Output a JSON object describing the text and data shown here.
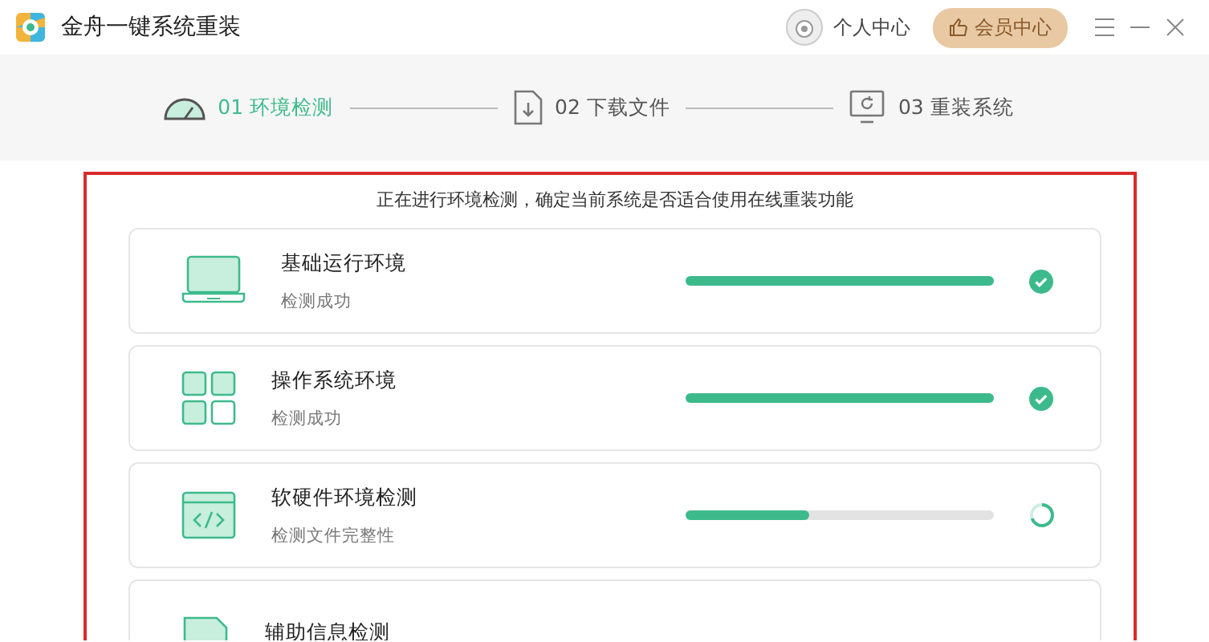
{
  "window": {
    "title": "金舟一键系统重装"
  },
  "header": {
    "profile": "个人中心",
    "vip": "会员中心"
  },
  "steps": [
    {
      "label": "01 环境检测",
      "selected": true
    },
    {
      "label": "02 下载文件",
      "selected": false
    },
    {
      "label": "03 重装系统",
      "selected": false
    }
  ],
  "notice": "正在进行环境检测，确定当前系统是否适合使用在线重装功能",
  "checks": [
    {
      "kind": "laptop",
      "title": "基础运行环境",
      "status": "检测成功",
      "level": 1,
      "completed": true
    },
    {
      "kind": "grid",
      "title": "操作系统环境",
      "status": "检测成功",
      "level": 1,
      "completed": true
    },
    {
      "kind": "code",
      "title": "软硬件环境检测",
      "status": "检测文件完整性",
      "level": 0.4,
      "completed": false,
      "in_progress": true
    },
    {
      "kind": "file",
      "title": "辅助信息检测"
    }
  ]
}
